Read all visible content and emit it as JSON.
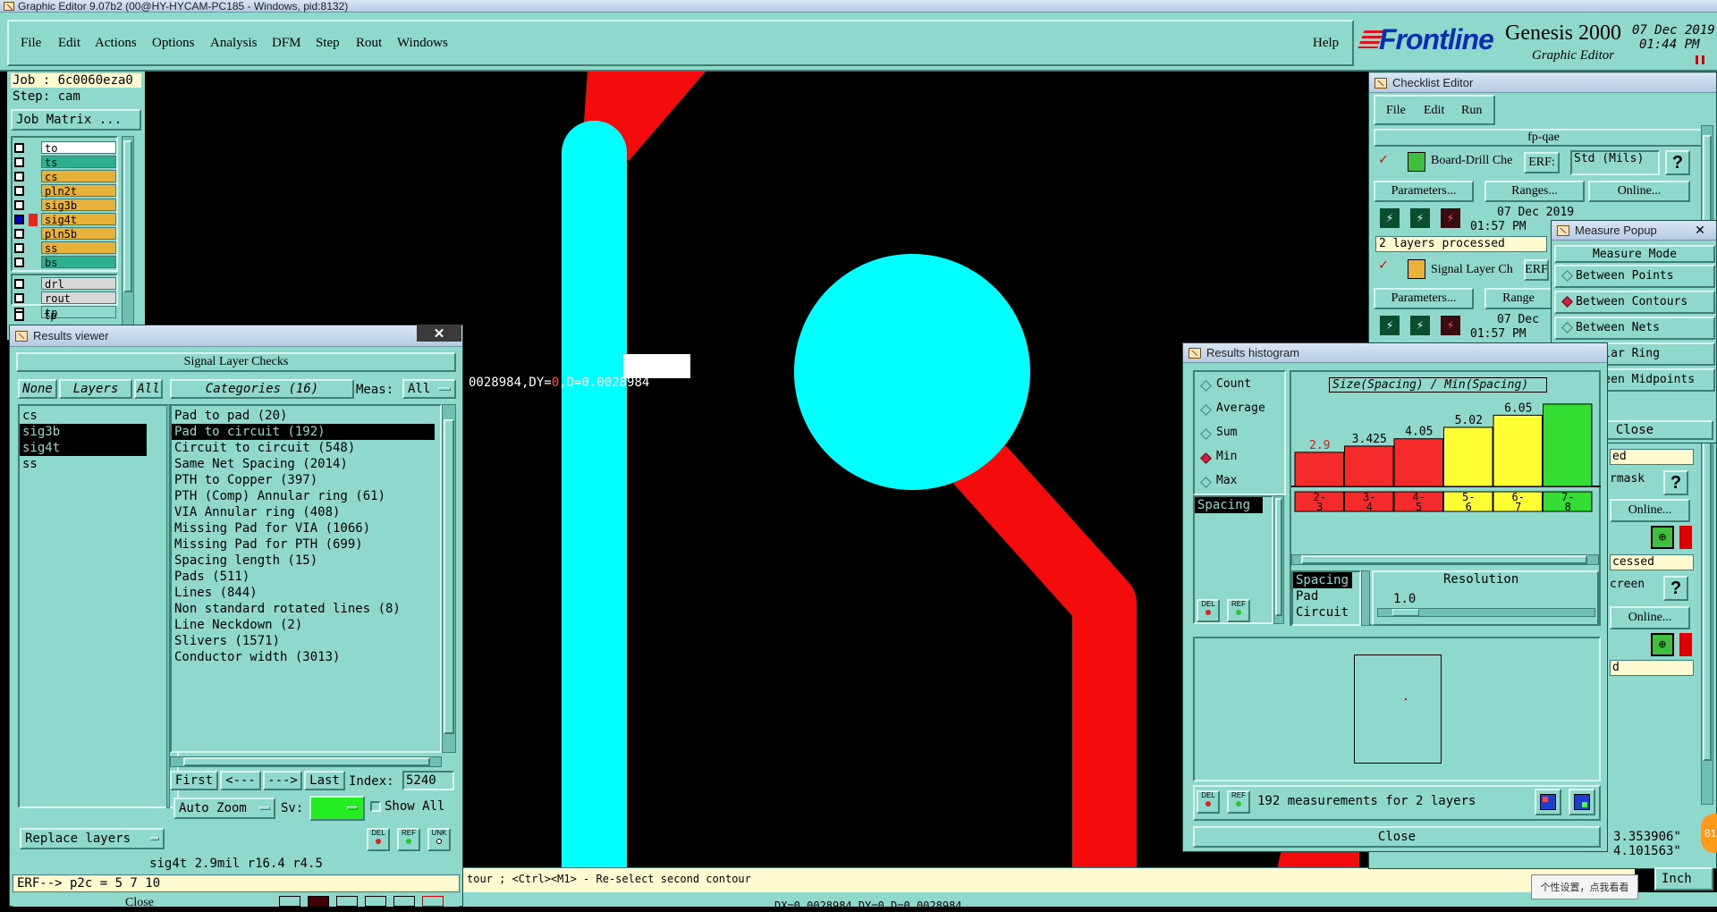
{
  "window": {
    "title": "Graphic Editor 9.07b2 (00@HY-HYCAM-PC185 - Windows, pid:8132)"
  },
  "menubar": {
    "items": [
      "File",
      "Edit",
      "Actions",
      "Options",
      "Analysis",
      "DFM",
      "Step",
      "Rout",
      "Windows"
    ],
    "help": "Help"
  },
  "brand": {
    "logo": "Frontline",
    "product": "Genesis 2000",
    "subtitle": "Graphic Editor",
    "date": "07 Dec 2019",
    "time": "01:44 PM"
  },
  "job": {
    "job_line": "Job : 6c0060eza0",
    "step_line": "Step: cam",
    "matrix_button": "Job Matrix ..."
  },
  "layers": {
    "items": [
      {
        "name": "to",
        "color": "#ffffff"
      },
      {
        "name": "ts",
        "color": "#2fb18f"
      },
      {
        "name": "cs",
        "color": "#e8b23a"
      },
      {
        "name": "pln2t",
        "color": "#e8b23a"
      },
      {
        "name": "sig3b",
        "color": "#e8b23a"
      },
      {
        "name": "sig4t",
        "color": "#e8b23a"
      },
      {
        "name": "pln5b",
        "color": "#e8b23a"
      },
      {
        "name": "ss",
        "color": "#e8b23a"
      },
      {
        "name": "bs",
        "color": "#2fb18f"
      }
    ],
    "extra": [
      {
        "name": "drl",
        "color": "#d8d8d8"
      },
      {
        "name": "rout",
        "color": "#d8d8d8"
      },
      {
        "name": "tp",
        "color": "#8fd8cc"
      }
    ]
  },
  "canvas": {
    "measure_text_white": "0028984,DY=",
    "measure_text_red1": "0",
    "measure_text_red2": ",D=0.0028984"
  },
  "results_viewer": {
    "title": "Results viewer",
    "header": "Signal Layer Checks",
    "none_btn": "None",
    "layers_btn": "Layers",
    "all_btn": "All",
    "categories_btn": "Categories (16)",
    "meas_label": "Meas:",
    "meas_value": "All",
    "layers_list": [
      "cs",
      "sig3b",
      "sig4t",
      "ss"
    ],
    "categories": [
      "Pad to pad (20)",
      "Pad to circuit (192)",
      "Circuit to circuit (548)",
      "Same Net Spacing (2014)",
      "PTH to Copper (397)",
      "PTH (Comp) Annular ring (61)",
      "VIA Annular ring (408)",
      "Missing Pad for VIA (1066)",
      "Missing Pad for PTH (699)",
      "Spacing length (15)",
      "Pads (511)",
      "Lines (844)",
      "Non standard rotated lines (8)",
      "Line Neckdown (2)",
      "Slivers (1571)",
      "Conductor width (3013)"
    ],
    "first": "First",
    "prev": "<---",
    "next": "--->",
    "last": "Last",
    "index_label": "Index:",
    "index_value": "5240",
    "auto_zoom": "Auto Zoom",
    "sv_label": "Sv:",
    "show_all": "Show All",
    "replace_layers": "Replace layers",
    "del": "DEL",
    "ref": "REF",
    "unk": "UNK",
    "status": "sig4t 2.9mil   r16.4   r4.5",
    "erf_line": "ERF--> p2c = 5 7 10",
    "close": "Close"
  },
  "checklist": {
    "title": "Checklist Editor",
    "menu": [
      "File",
      "Edit",
      "Run"
    ],
    "name": "fp-qae",
    "item1": {
      "name": "Board-Drill Che",
      "erf": "ERF:",
      "erf_value": "Std (Mils)",
      "params": "Parameters...",
      "ranges": "Ranges...",
      "online": "Online...",
      "date": "07 Dec 2019",
      "time": "01:57 PM",
      "status": "2 layers processed"
    },
    "item2": {
      "name": "Signal Layer Ch",
      "erf": "ERF",
      "params": "Parameters...",
      "ranges": "Range",
      "date": "07 Dec",
      "time": "01:57 PM"
    },
    "help": "?",
    "side_labels": [
      "ed",
      "rmask",
      "Online...",
      "cessed",
      "creen",
      "Online...",
      "d"
    ],
    "coord1": "3.353906\"",
    "coord2": "4.101563\"",
    "units": "Inch"
  },
  "measure_popup": {
    "title": "Measure Popup",
    "mode": "Measure Mode",
    "options": [
      {
        "label": "Between Points",
        "on": false
      },
      {
        "label": "Between Contours",
        "on": true
      },
      {
        "label": "Between Nets",
        "on": false
      },
      {
        "label": "Annular Ring",
        "on": false
      },
      {
        "label": "Between Midpoints",
        "on": false
      }
    ],
    "close": "Close"
  },
  "histogram": {
    "title": "Results histogram",
    "stats": [
      {
        "label": "Count",
        "on": false
      },
      {
        "label": "Average",
        "on": false
      },
      {
        "label": "Sum",
        "on": false
      },
      {
        "label": "Min",
        "on": true
      },
      {
        "label": "Max",
        "on": false
      }
    ],
    "meas_list": [
      "Spacing"
    ],
    "kinds": [
      "Spacing",
      "Pad",
      "Circuit"
    ],
    "resolution_label": "Resolution",
    "resolution_value": "1.0",
    "summary": "192 measurements for 2 layers",
    "close": "Close",
    "del": "DEL",
    "ref": "REF"
  },
  "chart_data": {
    "type": "bar",
    "title": "Size(Spacing) / Min(Spacing)",
    "categories": [
      "2-3",
      "3-4",
      "4-5",
      "5-6",
      "6-7",
      "7-8"
    ],
    "values": [
      2.9,
      3.425,
      4.05,
      5.02,
      6.05,
      7.0
    ],
    "value_labels": [
      "2.9",
      "3.425",
      "4.05",
      "5.02",
      "6.05",
      ""
    ],
    "colors": [
      "#f52a2a",
      "#f52a2a",
      "#f52a2a",
      "#ffff33",
      "#ffff33",
      "#33dd33"
    ],
    "ylim": [
      0,
      7.6
    ]
  },
  "statusbar": {
    "prompt": "tour ; <Ctrl><M1> - Re-select second contour",
    "bottom_coords": "DX=0.0028984,DY=0,D=0.0028984"
  },
  "tray": {
    "tooltip": "个性设置，点我看看",
    "badge": "81"
  }
}
